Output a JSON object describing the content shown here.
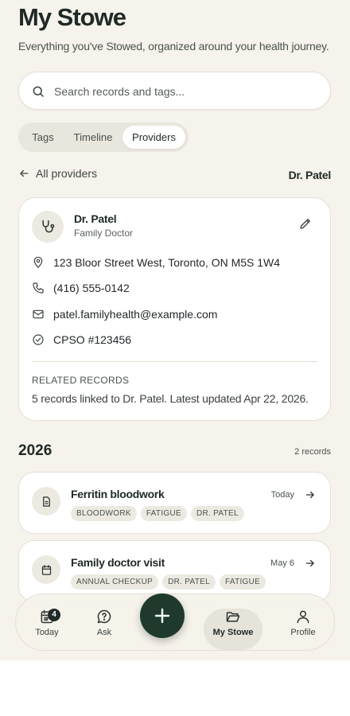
{
  "header": {
    "title": "My Stowe",
    "subtitle": "Everything you've Stowed, organized around your health journey."
  },
  "search": {
    "placeholder": "Search records and tags...",
    "value": ""
  },
  "segments": [
    {
      "label": "Tags",
      "active": false
    },
    {
      "label": "Timeline",
      "active": false
    },
    {
      "label": "Providers",
      "active": true
    }
  ],
  "breadcrumb": {
    "back_label": "All providers",
    "current": "Dr. Patel"
  },
  "provider": {
    "name": "Dr. Patel",
    "specialty": "Family Doctor",
    "address": "123 Bloor Street West, Toronto, ON M5S 1W4",
    "phone": "(416) 555-0142",
    "email": "patel.familyhealth@example.com",
    "registration": "CPSO #123456",
    "related_title": "RELATED RECORDS",
    "related_text": "5 records linked to Dr. Patel. Latest updated Apr 22, 2026."
  },
  "group": {
    "year": "2026",
    "count": "2 records"
  },
  "records": [
    {
      "title": "Ferritin bloodwork",
      "date": "Today",
      "icon": "document-icon",
      "tags": [
        "BLOODWORK",
        "FATIGUE",
        "DR. PATEL"
      ]
    },
    {
      "title": "Family doctor visit",
      "date": "May 6",
      "icon": "calendar-icon",
      "tags": [
        "ANNUAL CHECKUP",
        "DR. PATEL",
        "FATIGUE"
      ]
    }
  ],
  "nav": {
    "today": {
      "label": "Today",
      "badge": "4"
    },
    "ask": {
      "label": "Ask"
    },
    "stowe": {
      "label": "My Stowe",
      "active": true
    },
    "profile": {
      "label": "Profile"
    }
  },
  "colors": {
    "accent": "#1f3a2d",
    "background": "#f6f3ec",
    "card": "#ffffff",
    "tag": "#ece9e1"
  }
}
